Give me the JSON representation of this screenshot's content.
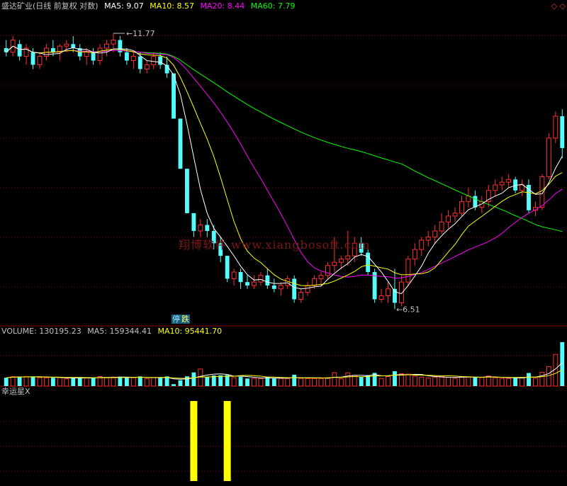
{
  "header": {
    "title": "盛达矿业(日线 前复权 对数)",
    "ma5": "MA5: 9.07",
    "ma10": "MA10: 8.57",
    "ma20": "MA20: 8.44",
    "ma60": "MA60: 7.79"
  },
  "volume_header": {
    "label": "VOLUME: 130195.23",
    "ma5": "MA5: 159344.41",
    "ma10": "MA10: 95441.70"
  },
  "indicator_header": {
    "label": "幸运星X"
  },
  "corner_icons": "◇ ◇",
  "watermark": "翔博软件  www.xiangbosoft.com",
  "badge": {
    "left": "停",
    "right": "跌"
  },
  "colors": {
    "up": "#ff3030",
    "down": "#54fcfc",
    "ma5": "#ffffff",
    "ma10": "#ffff00",
    "ma20": "#ff00ff",
    "ma60": "#00ff00",
    "grid": "#8b0000",
    "indicator": "#ffff00"
  },
  "chart_data": [
    {
      "type": "candlestick",
      "high_label": "11.77",
      "low_label": "6.51",
      "ylim": [
        6.3,
        12.3
      ],
      "grid": "dotted",
      "candles": [
        [
          11.4,
          11.6,
          11.2,
          11.3
        ],
        [
          11.3,
          11.7,
          11.2,
          11.6
        ],
        [
          11.5,
          11.6,
          11.1,
          11.2
        ],
        [
          11.2,
          11.5,
          11.0,
          11.4
        ],
        [
          11.3,
          11.4,
          10.9,
          11.0
        ],
        [
          11.0,
          11.3,
          10.9,
          11.2
        ],
        [
          11.2,
          11.5,
          11.1,
          11.4
        ],
        [
          11.4,
          11.6,
          11.2,
          11.3
        ],
        [
          11.3,
          11.5,
          11.1,
          11.45
        ],
        [
          11.45,
          11.6,
          11.3,
          11.5
        ],
        [
          11.5,
          11.7,
          11.3,
          11.4
        ],
        [
          11.4,
          11.5,
          11.1,
          11.2
        ],
        [
          11.2,
          11.4,
          11.0,
          11.3
        ],
        [
          11.3,
          11.4,
          11.0,
          11.1
        ],
        [
          11.1,
          11.5,
          11.0,
          11.4
        ],
        [
          11.4,
          11.6,
          11.2,
          11.5
        ],
        [
          11.5,
          11.77,
          11.3,
          11.6
        ],
        [
          11.6,
          11.7,
          11.2,
          11.3
        ],
        [
          11.3,
          11.4,
          11.0,
          11.1
        ],
        [
          11.1,
          11.3,
          10.9,
          11.2
        ],
        [
          11.2,
          11.3,
          10.8,
          10.9
        ],
        [
          10.9,
          11.1,
          10.8,
          11.0
        ],
        [
          11.0,
          11.3,
          10.9,
          11.2
        ],
        [
          11.2,
          11.3,
          10.9,
          11.0
        ],
        [
          11.0,
          11.2,
          10.7,
          10.8
        ],
        [
          10.8,
          10.8,
          9.8,
          9.8
        ],
        [
          9.8,
          9.8,
          8.8,
          8.8
        ],
        [
          8.8,
          8.8,
          8.0,
          8.0
        ],
        [
          8.0,
          8.0,
          7.6,
          7.7
        ],
        [
          7.7,
          7.9,
          7.6,
          7.8
        ],
        [
          7.8,
          7.9,
          7.6,
          7.7
        ],
        [
          7.7,
          7.8,
          7.4,
          7.5
        ],
        [
          7.5,
          7.6,
          7.2,
          7.3
        ],
        [
          7.3,
          7.3,
          6.9,
          6.95
        ],
        [
          6.95,
          7.1,
          6.85,
          7.05
        ],
        [
          7.05,
          7.1,
          6.8,
          6.9
        ],
        [
          6.9,
          7.0,
          6.8,
          6.85
        ],
        [
          6.85,
          7.0,
          6.8,
          6.9
        ],
        [
          6.9,
          7.05,
          6.85,
          7.0
        ],
        [
          7.0,
          7.1,
          6.8,
          6.85
        ],
        [
          6.85,
          6.95,
          6.75,
          6.8
        ],
        [
          6.8,
          6.9,
          6.7,
          6.85
        ],
        [
          6.85,
          7.0,
          6.8,
          6.95
        ],
        [
          6.95,
          7.0,
          6.6,
          6.65
        ],
        [
          6.65,
          6.8,
          6.6,
          6.75
        ],
        [
          6.75,
          6.9,
          6.7,
          6.85
        ],
        [
          6.85,
          7.0,
          6.8,
          6.95
        ],
        [
          6.95,
          7.05,
          6.85,
          7.0
        ],
        [
          7.0,
          7.2,
          6.95,
          7.15
        ],
        [
          7.15,
          7.6,
          7.05,
          7.2
        ],
        [
          7.2,
          7.3,
          7.1,
          7.25
        ],
        [
          7.25,
          7.7,
          7.15,
          7.3
        ],
        [
          7.3,
          7.6,
          7.2,
          7.5
        ],
        [
          7.5,
          7.6,
          7.3,
          7.35
        ],
        [
          7.35,
          7.4,
          7.0,
          7.05
        ],
        [
          7.05,
          7.1,
          6.6,
          6.65
        ],
        [
          6.65,
          6.8,
          6.6,
          6.7
        ],
        [
          6.7,
          6.9,
          6.6,
          6.8
        ],
        [
          6.8,
          7.1,
          6.51,
          6.6
        ],
        [
          6.6,
          7.0,
          6.55,
          6.9
        ],
        [
          6.9,
          7.3,
          6.85,
          7.25
        ],
        [
          7.25,
          7.5,
          7.15,
          7.4
        ],
        [
          7.4,
          7.6,
          7.3,
          7.55
        ],
        [
          7.55,
          7.7,
          7.45,
          7.6
        ],
        [
          7.6,
          7.8,
          7.5,
          7.7
        ],
        [
          7.7,
          8.0,
          7.65,
          7.85
        ],
        [
          7.85,
          8.05,
          7.75,
          7.95
        ],
        [
          7.95,
          8.1,
          7.85,
          8.0
        ],
        [
          8.0,
          8.3,
          7.95,
          8.2
        ],
        [
          8.2,
          8.45,
          8.1,
          8.3
        ],
        [
          8.3,
          8.4,
          8.05,
          8.1
        ],
        [
          8.1,
          8.3,
          8.0,
          8.2
        ],
        [
          8.2,
          8.5,
          8.1,
          8.4
        ],
        [
          8.4,
          8.6,
          8.3,
          8.5
        ],
        [
          8.5,
          8.65,
          8.4,
          8.55
        ],
        [
          8.55,
          8.7,
          8.45,
          8.6
        ],
        [
          8.6,
          8.65,
          8.35,
          8.4
        ],
        [
          8.4,
          8.6,
          8.3,
          8.5
        ],
        [
          8.5,
          8.6,
          8.0,
          8.05
        ],
        [
          8.05,
          8.2,
          7.95,
          8.1
        ],
        [
          8.1,
          8.7,
          8.05,
          8.65
        ],
        [
          8.65,
          9.5,
          8.6,
          9.4
        ],
        [
          9.4,
          9.95,
          9.3,
          9.85
        ],
        [
          9.85,
          10.0,
          9.0,
          9.2
        ]
      ]
    },
    {
      "type": "bar",
      "name": "volume",
      "ylim": [
        0,
        100
      ]
    },
    {
      "type": "bar",
      "name": "indicator",
      "ylim": [
        0,
        1
      ]
    }
  ]
}
